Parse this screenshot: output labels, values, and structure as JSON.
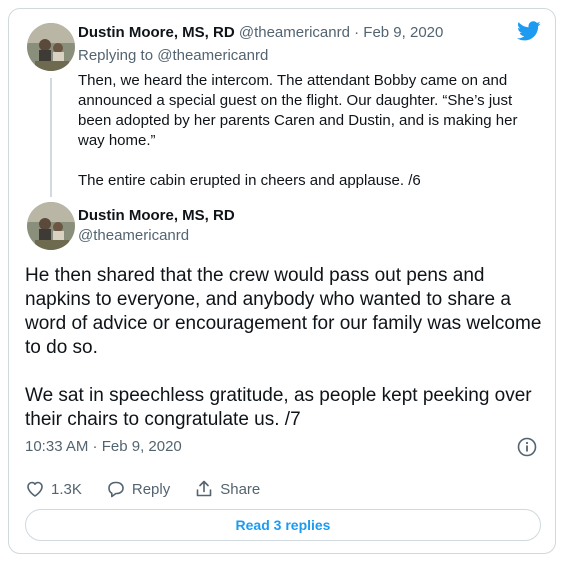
{
  "quoted_tweet": {
    "author_name": "Dustin Moore, MS, RD",
    "author_handle": "@theamericanrd",
    "separator": "·",
    "date": "Feb 9, 2020",
    "replying_to_prefix": "Replying to",
    "replying_to_handle": "@theamericanrd",
    "paragraphs": [
      "Then, we heard the intercom. The attendant Bobby came on and announced a special guest on the flight. Our daughter. “She’s just been adopted by her parents Caren and Dustin, and is making her way home.”",
      "The entire cabin erupted in cheers and applause. /6"
    ]
  },
  "main_tweet": {
    "author_name": "Dustin Moore, MS, RD",
    "author_handle": "@theamericanrd",
    "paragraphs": [
      "He then shared that the crew would pass out pens and napkins to everyone, and anybody who wanted to share a word of advice or encouragement for our family was welcome to do so.",
      "We sat in speechless gratitude, as people kept peeking over their chairs to congratulate us. /7"
    ],
    "timestamp": "10:33 AM · Feb 9, 2020"
  },
  "actions": {
    "like_count": "1.3K",
    "reply_label": "Reply",
    "share_label": "Share"
  },
  "read_replies_label": "Read 3 replies",
  "colors": {
    "accent": "#1d9bf0",
    "text": "#0f1419",
    "muted": "#536471",
    "border": "#cfd9de"
  },
  "icons": [
    "twitter-bird-icon",
    "info-icon",
    "heart-icon",
    "reply-bubble-icon",
    "share-icon"
  ]
}
